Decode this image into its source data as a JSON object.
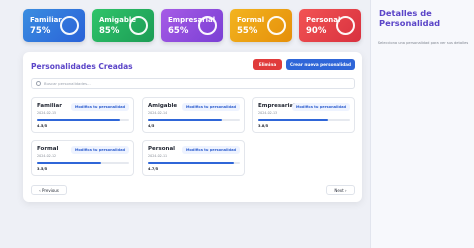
{
  "stats": [
    {
      "name": "Familiar",
      "value": "75%",
      "color_from": "#3a8de0",
      "color_to": "#2a62d8"
    },
    {
      "name": "Amigable",
      "value": "85%",
      "color_from": "#2fc46a",
      "color_to": "#1c9c55"
    },
    {
      "name": "Empresarial",
      "value": "65%",
      "color_from": "#a65be6",
      "color_to": "#7a3fd4"
    },
    {
      "name": "Formal",
      "value": "55%",
      "color_from": "#f3b41f",
      "color_to": "#e58f0a"
    },
    {
      "name": "Personal",
      "value": "90%",
      "color_from": "#f25353",
      "color_to": "#d8313f"
    }
  ],
  "main": {
    "title": "Personalidades Creadas",
    "delete_label": "Elimina",
    "create_label": "Crear nueva personalidad",
    "search_placeholder": "Buscar personalidades...",
    "cards": [
      {
        "name": "Familiar",
        "date": "2024-02-15",
        "modify_label": "Modifica tu personalidad",
        "score": "4.5/5",
        "fill": 0.9
      },
      {
        "name": "Amigable",
        "date": "2024-02-14",
        "modify_label": "Modifica tu personalidad",
        "score": "4/5",
        "fill": 0.8
      },
      {
        "name": "Empresarial",
        "date": "2024-02-13",
        "modify_label": "Modifica tu personalidad",
        "score": "3.8/5",
        "fill": 0.76
      },
      {
        "name": "Formal",
        "date": "2024-02-12",
        "modify_label": "Modifica tu personalidad",
        "score": "3.5/5",
        "fill": 0.7
      },
      {
        "name": "Personal",
        "date": "2024-02-11",
        "modify_label": "Modifica tu personalidad",
        "score": "4.7/5",
        "fill": 0.94
      }
    ],
    "prev_label": "‹ Previous",
    "next_label": "Next ›"
  },
  "side": {
    "title": "Detalles de Personalidad",
    "hint": "Selecciona una personalidad para ver sus detalles"
  }
}
